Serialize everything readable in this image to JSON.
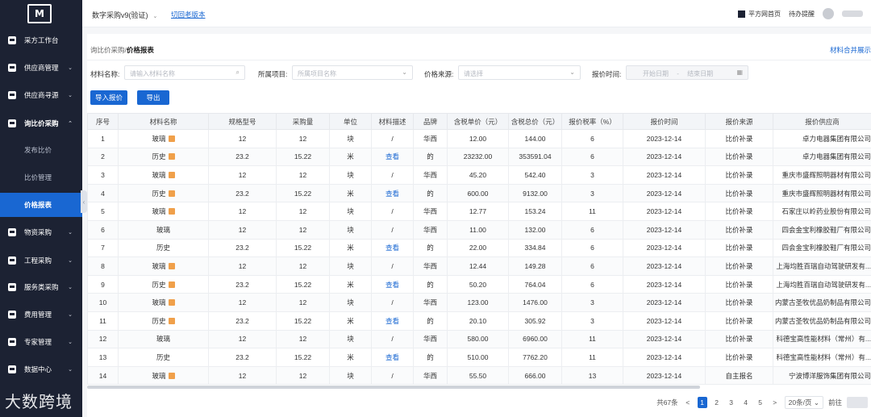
{
  "sidebar": {
    "logo_text": "M",
    "items": [
      {
        "label": "采方工作台",
        "icon": "home-icon"
      },
      {
        "label": "供应商管理",
        "icon": "supplier-icon",
        "chev": "⌄"
      },
      {
        "label": "供应商寻源",
        "icon": "source-icon",
        "chev": "⌄"
      },
      {
        "label": "询比价采购",
        "icon": "inquiry-icon",
        "chev": "⌃"
      },
      {
        "label": "物资采购",
        "icon": "goods-icon",
        "chev": "⌄"
      },
      {
        "label": "工程采购",
        "icon": "project-icon",
        "chev": "⌄"
      },
      {
        "label": "服务类采购",
        "icon": "service-icon",
        "chev": "⌄"
      },
      {
        "label": "费用管理",
        "icon": "fee-icon",
        "chev": "⌄"
      },
      {
        "label": "专家管理",
        "icon": "expert-icon",
        "chev": "⌄"
      },
      {
        "label": "数据中心",
        "icon": "data-icon",
        "chev": "⌄"
      }
    ],
    "sub_items": [
      {
        "label": "发布比价"
      },
      {
        "label": "比价管理"
      },
      {
        "label": "价格报表"
      }
    ],
    "watermark": "大数跨境"
  },
  "topbar": {
    "app_title": "数字采购v9(验证)",
    "switch_link": "切回老版本",
    "home_link": "平方网首页",
    "todo": "待办提醒"
  },
  "page": {
    "crumb_parent": "询比价采购",
    "crumb_sep": "/",
    "crumb_current": "价格报表",
    "merge_link": "材料合并展示",
    "filters": {
      "material_label": "材料名称:",
      "material_placeholder": "请输入材料名称",
      "project_label": "所属项目:",
      "project_placeholder": "所属项目名称",
      "source_label": "价格来源:",
      "source_placeholder": "请选择",
      "time_label": "报价时间:",
      "start_placeholder": "开始日期",
      "range_sep": "-",
      "end_placeholder": "结束日期"
    },
    "buttons": {
      "import": "导入报价",
      "export": "导出"
    }
  },
  "table": {
    "headers": [
      "序号",
      "材料名称",
      "规格型号",
      "采购量",
      "单位",
      "材料描述",
      "品牌",
      "含税单价（元）",
      "含税总价（元）",
      "报价税率（%）",
      "报价时间",
      "报价来源",
      "报价供应商"
    ],
    "rows": [
      [
        "1",
        "玻璃",
        "12",
        "12",
        "块",
        "/",
        "华西",
        "12.00",
        "144.00",
        "6",
        "2023-12-14",
        "比价补录",
        "卓力电器集团有限公司"
      ],
      [
        "2",
        "历史",
        "23.2",
        "15.22",
        "米",
        "查看",
        "的",
        "23232.00",
        "353591.04",
        "6",
        "2023-12-14",
        "比价补录",
        "卓力电器集团有限公司"
      ],
      [
        "3",
        "玻璃",
        "12",
        "12",
        "块",
        "/",
        "华西",
        "45.20",
        "542.40",
        "3",
        "2023-12-14",
        "比价补录",
        "重庆市盛辉照明器材有限公司"
      ],
      [
        "4",
        "历史",
        "23.2",
        "15.22",
        "米",
        "查看",
        "的",
        "600.00",
        "9132.00",
        "3",
        "2023-12-14",
        "比价补录",
        "重庆市盛辉照明器材有限公司"
      ],
      [
        "5",
        "玻璃",
        "12",
        "12",
        "块",
        "/",
        "华西",
        "12.77",
        "153.24",
        "11",
        "2023-12-14",
        "比价补录",
        "石家庄以岭药业股份有限公司"
      ],
      [
        "6",
        "玻璃",
        "12",
        "12",
        "块",
        "/",
        "华西",
        "11.00",
        "132.00",
        "6",
        "2023-12-14",
        "比价补录",
        "四会金宝利橡胶鞋厂有限公司"
      ],
      [
        "7",
        "历史",
        "23.2",
        "15.22",
        "米",
        "查看",
        "的",
        "22.00",
        "334.84",
        "6",
        "2023-12-14",
        "比价补录",
        "四会金宝利橡胶鞋厂有限公司"
      ],
      [
        "8",
        "玻璃",
        "12",
        "12",
        "块",
        "/",
        "华西",
        "12.44",
        "149.28",
        "6",
        "2023-12-14",
        "比价补录",
        "上海均胜百瑞自动驾驶研发有..."
      ],
      [
        "9",
        "历史",
        "23.2",
        "15.22",
        "米",
        "查看",
        "的",
        "50.20",
        "764.04",
        "6",
        "2023-12-14",
        "比价补录",
        "上海均胜百瑞自动驾驶研发有..."
      ],
      [
        "10",
        "玻璃",
        "12",
        "12",
        "块",
        "/",
        "华西",
        "123.00",
        "1476.00",
        "3",
        "2023-12-14",
        "比价补录",
        "内蒙古圣牧优品奶制品有限公司"
      ],
      [
        "11",
        "历史",
        "23.2",
        "15.22",
        "米",
        "查看",
        "的",
        "20.10",
        "305.92",
        "3",
        "2023-12-14",
        "比价补录",
        "内蒙古圣牧优品奶制品有限公司"
      ],
      [
        "12",
        "玻璃",
        "12",
        "12",
        "块",
        "/",
        "华西",
        "580.00",
        "6960.00",
        "11",
        "2023-12-14",
        "比价补录",
        "科德宝高性能材料（常州）有..."
      ],
      [
        "13",
        "历史",
        "23.2",
        "15.22",
        "米",
        "查看",
        "的",
        "510.00",
        "7762.20",
        "11",
        "2023-12-14",
        "比价补录",
        "科德宝高性能材料（常州）有..."
      ],
      [
        "14",
        "玻璃",
        "12",
        "12",
        "块",
        "/",
        "华西",
        "55.50",
        "666.00",
        "13",
        "2023-12-14",
        "自主报名",
        "宁波博洋服饰集团有限公司"
      ]
    ],
    "tagged_rows": [
      0,
      1,
      2,
      3,
      4,
      7,
      8,
      9,
      10,
      13
    ]
  },
  "pager": {
    "total": "共67条",
    "prev": "<",
    "pages": [
      "1",
      "2",
      "3",
      "4",
      "5"
    ],
    "current": "1",
    "next": ">",
    "size": "20条/页",
    "jump_label": "前往"
  },
  "colors": {
    "sidebar_bg": "#1c2233",
    "accent": "#1967d2",
    "tag": "#f0a04a"
  }
}
